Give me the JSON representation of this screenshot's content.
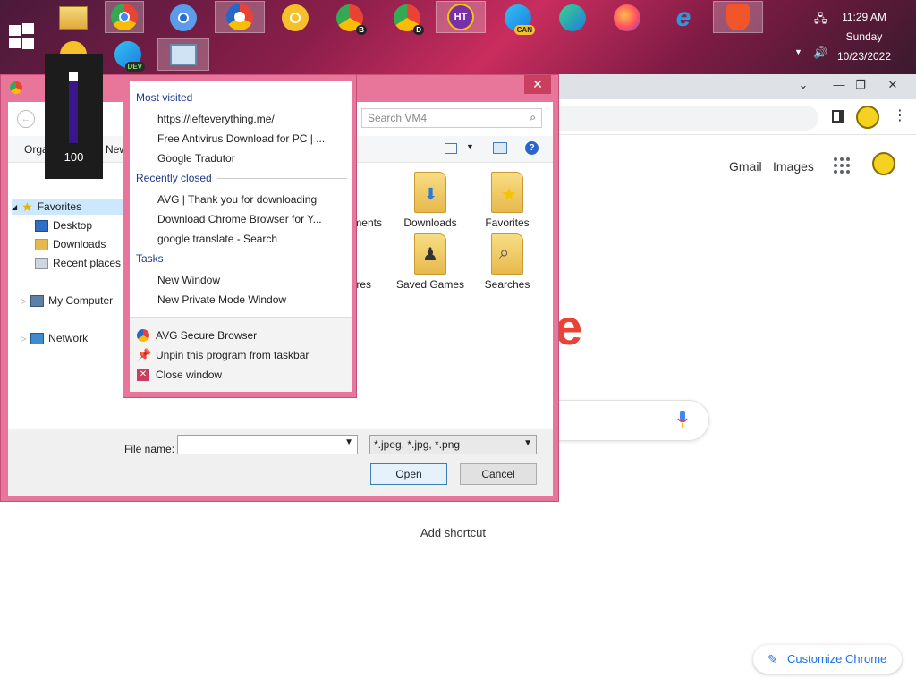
{
  "taskbar": {
    "clock_time": "11:29 AM",
    "clock_day": "Sunday",
    "clock_date": "10/23/2022",
    "pinned": [
      {
        "name": "file-explorer-icon"
      },
      {
        "name": "chrome-icon"
      },
      {
        "name": "chromium-icon"
      },
      {
        "name": "avg-secure-browser-icon"
      },
      {
        "name": "chrome-canary-icon"
      },
      {
        "name": "chrome-beta-icon",
        "badge": "B"
      },
      {
        "name": "chrome-dev-icon",
        "badge": "D"
      },
      {
        "name": "ht-app-icon",
        "label": "HT"
      },
      {
        "name": "edge-canary-icon",
        "badge": "CAN"
      },
      {
        "name": "edge-icon"
      },
      {
        "name": "firefox-icon"
      },
      {
        "name": "internet-explorer-icon"
      },
      {
        "name": "brave-icon"
      },
      {
        "name": "edge-dev-icon",
        "badge": "DEV"
      },
      {
        "name": "resource-monitor-icon"
      }
    ]
  },
  "volume": {
    "level": "100"
  },
  "chrome": {
    "gmail": "Gmail",
    "images": "Images",
    "add_shortcut": "Add shortcut",
    "customize": "Customize Chrome",
    "logo_fragment": "e"
  },
  "dialog": {
    "search_placeholder": "Search VM4",
    "organize": "Orga",
    "new_folder": "New",
    "tree": {
      "favorites": "Favorites",
      "desktop": "Desktop",
      "downloads": "Downloads",
      "recent": "Recent places",
      "my_computer": "My Computer",
      "network": "Network"
    },
    "folders": [
      {
        "name": "ments"
      },
      {
        "name": "Downloads"
      },
      {
        "name": "Favorites"
      },
      {
        "name": "res"
      },
      {
        "name": "Saved Games"
      },
      {
        "name": "Searches"
      }
    ],
    "file_name_label": "File name:",
    "file_type": "*.jpeg, *.jpg, *.png",
    "open": "Open",
    "cancel": "Cancel"
  },
  "jumplist": {
    "most_visited": "Most visited",
    "mv_items": [
      "https://lefteverything.me/",
      "Free Antivirus Download for PC | ...",
      "Google Tradutor"
    ],
    "recently_closed": "Recently closed",
    "rc_items": [
      "AVG | Thank you for downloading",
      "Download Chrome Browser for Y...",
      "google translate - Search"
    ],
    "tasks": "Tasks",
    "task_items": [
      "New Window",
      "New Private Mode Window"
    ],
    "footer": [
      "AVG Secure Browser",
      "Unpin this program from taskbar",
      "Close window"
    ]
  }
}
